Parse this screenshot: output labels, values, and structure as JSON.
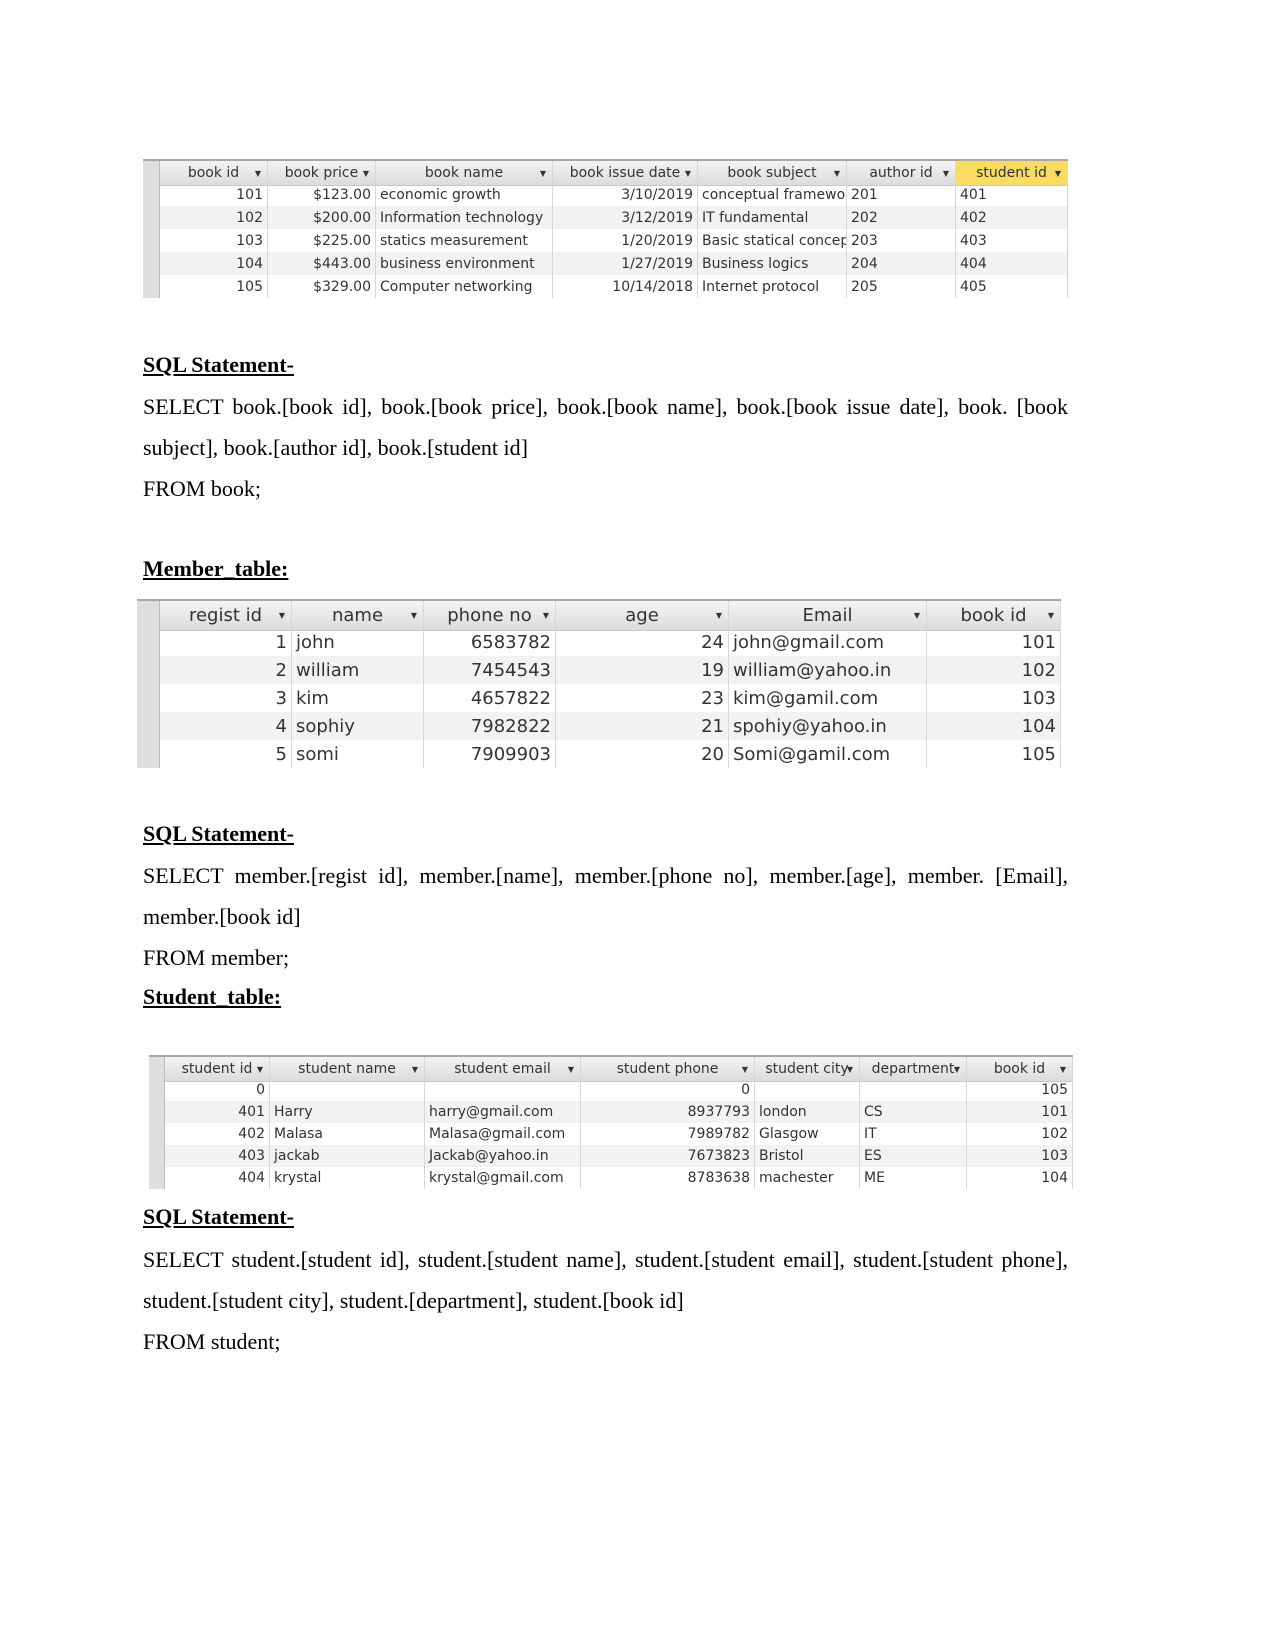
{
  "book_table": {
    "columns": [
      "book id",
      "book price",
      "book name",
      "book issue date",
      "book subject",
      "author id",
      "student id"
    ],
    "align": [
      "r",
      "r",
      "l",
      "r",
      "l",
      "l",
      "l"
    ],
    "rows": [
      [
        "101",
        "$123.00",
        "economic growth",
        "3/10/2019",
        "conceptual framewo",
        "201",
        "401"
      ],
      [
        "102",
        "$200.00",
        "Information technology",
        "3/12/2019",
        "IT fundamental",
        "202",
        "402"
      ],
      [
        "103",
        "$225.00",
        "statics measurement",
        "1/20/2019",
        "Basic statical concep",
        "203",
        "403"
      ],
      [
        "104",
        "$443.00",
        "business environment",
        "1/27/2019",
        "Business logics",
        "204",
        "404"
      ],
      [
        "105",
        "$329.00",
        "Computer networking",
        "10/14/2018",
        "Internet protocol",
        "205",
        "405"
      ]
    ],
    "selected_column": 6,
    "highlight_color": "#fbdc63"
  },
  "sql1": {
    "heading": "SQL Statement-",
    "line1": "SELECT book.[book id], book.[book price], book.[book name], book.[book issue date], book. [book subject], book.[author id], book.[student id]",
    "line2": "FROM book;"
  },
  "member_heading": "Member_table:",
  "member_table": {
    "columns": [
      "regist id",
      "name",
      "phone no",
      "age",
      "Email",
      "book id"
    ],
    "align": [
      "r",
      "l",
      "r",
      "r",
      "l",
      "r"
    ],
    "rows": [
      [
        "1",
        "john",
        "6583782",
        "24",
        "john@gmail.com",
        "101"
      ],
      [
        "2",
        "william",
        "7454543",
        "19",
        "william@yahoo.in",
        "102"
      ],
      [
        "3",
        "kim",
        "4657822",
        "23",
        "kim@gamil.com",
        "103"
      ],
      [
        "4",
        "sophiy",
        "7982822",
        "21",
        "spohiy@yahoo.in",
        "104"
      ],
      [
        "5",
        "somi",
        "7909903",
        "20",
        "Somi@gamil.com",
        "105"
      ]
    ]
  },
  "sql2": {
    "heading": "SQL Statement-",
    "line1": "SELECT member.[regist id], member.[name], member.[phone no], member.[age], member. [Email], member.[book id]",
    "line2": "FROM member;"
  },
  "student_heading": "Student_table:",
  "student_table": {
    "columns": [
      "student id",
      "student name",
      "student email",
      "student phone",
      "student city",
      "department",
      "book id"
    ],
    "align": [
      "r",
      "l",
      "l",
      "r",
      "l",
      "l",
      "r"
    ],
    "rows": [
      [
        "0",
        "",
        "",
        "0",
        "",
        "",
        "105"
      ],
      [
        "401",
        "Harry",
        "harry@gmail.com",
        "8937793",
        "london",
        "CS",
        "101"
      ],
      [
        "402",
        "Malasa",
        "Malasa@gmail.com",
        "7989782",
        "Glasgow",
        "IT",
        "102"
      ],
      [
        "403",
        "jackab",
        "Jackab@yahoo.in",
        "7673823",
        "Bristol",
        "ES",
        "103"
      ],
      [
        "404",
        "krystal",
        "krystal@gmail.com",
        "8783638",
        "machester",
        "ME",
        "104"
      ]
    ]
  },
  "sql3": {
    "heading": "SQL Statement-",
    "line1": "SELECT student.[student id], student.[student name], student.[student email], student.[student phone], student.[student city], student.[department], student.[book id]",
    "line2": "FROM student;"
  },
  "icons": {
    "dropdown": "dropdown-arrow-icon"
  }
}
